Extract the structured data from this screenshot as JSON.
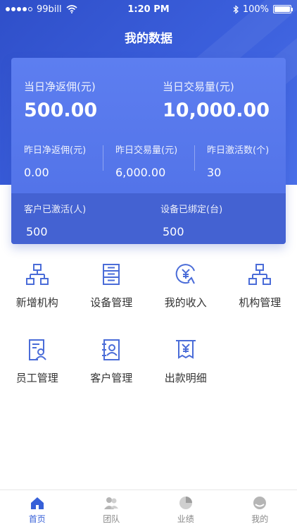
{
  "status_bar": {
    "carrier": "99bill",
    "time": "1:20 PM",
    "battery": "100%",
    "signal_bars_filled": 4,
    "signal_bars_total": 5
  },
  "header": {
    "title": "我的数据"
  },
  "summary": {
    "today_rebate_label": "当日净返佣(元)",
    "today_rebate_value": "500.00",
    "today_volume_label": "当日交易量(元)",
    "today_volume_value": "10,000.00",
    "yesterday": [
      {
        "label": "昨日净返佣(元)",
        "value": "0.00"
      },
      {
        "label": "昨日交易量(元)",
        "value": "6,000.00"
      },
      {
        "label": "昨日激活数(个)",
        "value": "30"
      }
    ],
    "activated_customers_label": "客户已激活(人)",
    "activated_customers_value": "500",
    "bound_devices_label": "设备已绑定(台)",
    "bound_devices_value": "500"
  },
  "menu": [
    {
      "label": "新增机构",
      "icon": "org-tree-icon"
    },
    {
      "label": "设备管理",
      "icon": "device-cabinet-icon"
    },
    {
      "label": "我的收入",
      "icon": "income-yuan-icon"
    },
    {
      "label": "机构管理",
      "icon": "org-tree-icon"
    },
    {
      "label": "员工管理",
      "icon": "employee-card-icon"
    },
    {
      "label": "客户管理",
      "icon": "customer-book-icon"
    },
    {
      "label": "出款明细",
      "icon": "payout-receipt-icon"
    }
  ],
  "tabbar": [
    {
      "label": "首页",
      "icon": "home-icon",
      "active": true
    },
    {
      "label": "团队",
      "icon": "team-icon",
      "active": false
    },
    {
      "label": "业绩",
      "icon": "pie-chart-icon",
      "active": false
    },
    {
      "label": "我的",
      "icon": "profile-icon",
      "active": false
    }
  ],
  "colors": {
    "primary": "#3b5fdc",
    "card": "#5777ec",
    "card_band": "#4462d2",
    "icon": "#4a6cd8",
    "tab_active": "#3760d8",
    "tab_inactive": "#b5b5b5"
  }
}
